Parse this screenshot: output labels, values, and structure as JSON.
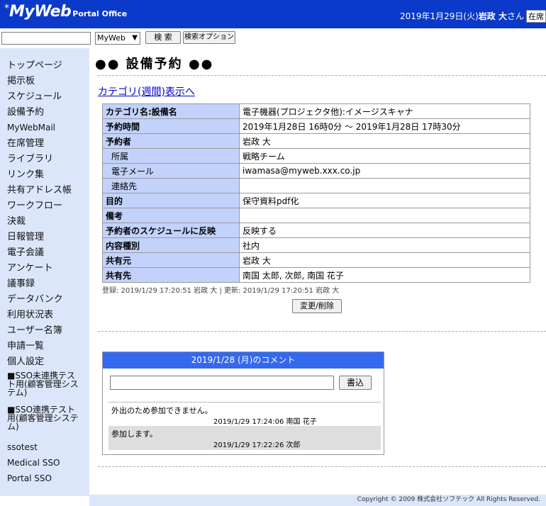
{
  "header": {
    "logo_star": "*",
    "logo_main": "MyWeb",
    "logo_sub": "Portal Office",
    "date": "2019年1月29日(火)",
    "user_name": "岩政 大",
    "user_suffix": "さん",
    "presence": "在席"
  },
  "search": {
    "placeholder": "",
    "scope": "MyWeb",
    "search_button": "検 索",
    "option_button": "検索オプション"
  },
  "sidebar": {
    "items": [
      "トップページ",
      "掲示板",
      "スケジュール",
      "設備予約",
      "MyWebMail",
      "在席管理",
      "ライブラリ",
      "リンク集",
      "共有アドレス帳",
      "ワークフロー",
      "決裁",
      "日報管理",
      "電子会議",
      "アンケート",
      "議事録",
      "データバンク",
      "利用状況表",
      "ユーザー名簿",
      "申請一覧",
      "個人設定",
      "■SSO未連携テスト用(顧客管理システム)",
      "■SSO連携テスト用(顧客管理システム)",
      "ssotest",
      "Medical SSO",
      "Portal SSO"
    ]
  },
  "page": {
    "title": "●● 設備予約 ●●",
    "category_link": "カテゴリ(週間)表示へ"
  },
  "detail": {
    "rows": [
      {
        "label": "カテゴリ名:設備名",
        "value": "電子機器(プロジェクタ他):イメージスキャナ"
      },
      {
        "label": "予約時間",
        "value": "2019年1月28日 16時0分 〜 2019年1月28日 17時30分"
      },
      {
        "label": "予約者",
        "value": "岩政 大"
      },
      {
        "label": "所属",
        "value": "戦略チーム"
      },
      {
        "label": "電子メール",
        "value": "iwamasa@myweb.xxx.co.jp"
      },
      {
        "label": "連絡先",
        "value": ""
      },
      {
        "label": "目的",
        "value": "保守資料pdf化"
      },
      {
        "label": "備考",
        "value": ""
      },
      {
        "label": "予約者のスケジュールに反映",
        "value": "反映する"
      },
      {
        "label": "内容種別",
        "value": "社内"
      },
      {
        "label": "共有元",
        "value": "岩政 大"
      },
      {
        "label": "共有先",
        "value": "南国 太郎, 次郎, 南国 花子"
      }
    ],
    "registered": "登録: 2019/1/29 17:20:51 岩政 大 | 更新: 2019/1/29 17:20:51 岩政 大",
    "change_button": "変更/削除"
  },
  "comments": {
    "header": "2019/1/28 (月)のコメント",
    "input_value": "",
    "write_button": "書込",
    "items": [
      {
        "text": "外出のため参加できません。",
        "meta": "2019/1/29 17:24:06 南国 花子"
      },
      {
        "text": "参加します。",
        "meta": "2019/1/29 17:22:26 次郎"
      }
    ]
  },
  "footer": {
    "copyright": "Copyright © 2009 株式会社ソフテック All Rights Reserved."
  },
  "colors": {
    "header_bg": "#0b39c9",
    "sidebar_bg": "#dbe6fb",
    "table_header_bg": "#c3d2fb",
    "comment_header_bg": "#3468ee"
  }
}
